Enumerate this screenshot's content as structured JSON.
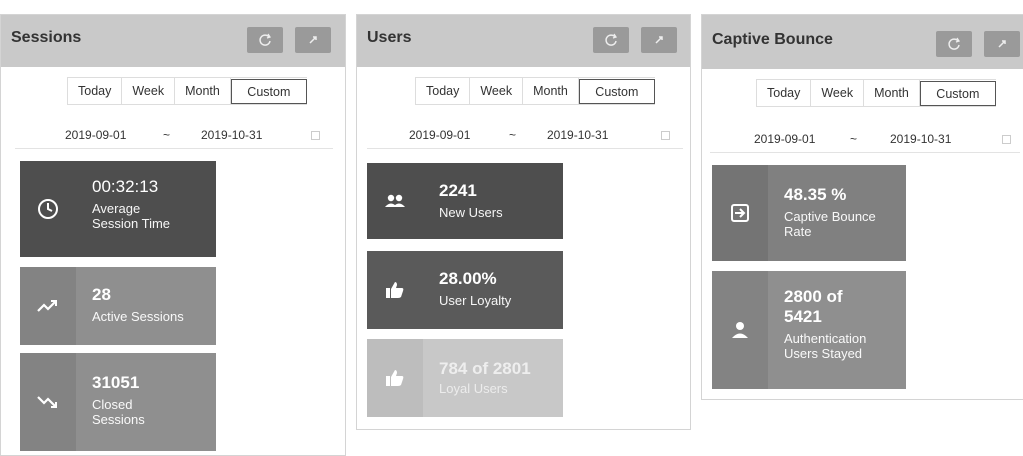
{
  "sessions": {
    "title": "Sessions",
    "tabs": [
      "Today",
      "Week",
      "Month",
      "Custom"
    ],
    "date_from": "2019-09-01",
    "date_sep": "~",
    "date_to": "2019-10-31",
    "cards": [
      {
        "value": "00:32:13",
        "label": "Average\nSession Time",
        "icon": "clock-icon"
      },
      {
        "value": "28",
        "label": "Active Sessions",
        "icon": "trending-up-icon"
      },
      {
        "value": "31051",
        "label": "Closed\nSessions",
        "icon": "trending-down-icon"
      }
    ]
  },
  "users": {
    "title": "Users",
    "tabs": [
      "Today",
      "Week",
      "Month",
      "Custom"
    ],
    "date_from": "2019-09-01",
    "date_sep": "~",
    "date_to": "2019-10-31",
    "cards": [
      {
        "value": "2241",
        "label": "New Users",
        "icon": "people-icon"
      },
      {
        "value": "28.00%",
        "label": "User Loyalty",
        "icon": "thumbs-up-icon"
      },
      {
        "value": "784 of 2801",
        "label": "Loyal Users",
        "icon": "thumbs-up-icon"
      }
    ]
  },
  "captive": {
    "title": "Captive Bounce",
    "tabs": [
      "Today",
      "Week",
      "Month",
      "Custom"
    ],
    "date_from": "2019-09-01",
    "date_sep": "~",
    "date_to": "2019-10-31",
    "cards": [
      {
        "value": "48.35 %",
        "label": "Captive Bounce\nRate",
        "icon": "exit-icon"
      },
      {
        "value": "2800 of\n5421",
        "label": "Authentication\nUsers Stayed",
        "icon": "person-icon"
      }
    ]
  },
  "colors": {
    "header": "#c9c9c9",
    "card_dark": "#4e4e4e",
    "card_mid": "#8f8f8f",
    "card_light": "#c8c8c8"
  }
}
